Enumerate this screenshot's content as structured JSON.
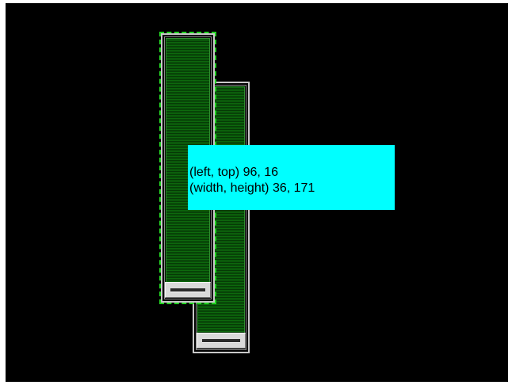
{
  "tooltip": {
    "line1": "(left, top) 96, 16",
    "line2": "(width, height) 36, 171"
  },
  "colors": {
    "canvas_background": "#000000",
    "slider_track_fill": "#0d6a0d",
    "selection_outline": "#22d422",
    "tooltip_background": "#00ffff"
  },
  "icons": {
    "slider_thumb": "slider-thumb-icon"
  }
}
